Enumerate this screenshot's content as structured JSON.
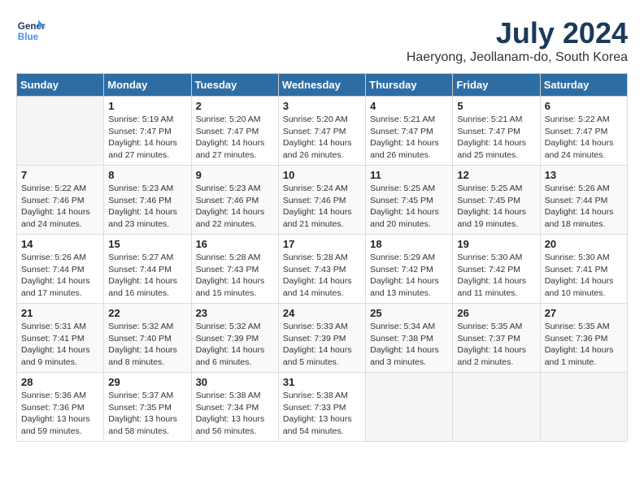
{
  "logo": {
    "line1": "General",
    "line2": "Blue"
  },
  "title": "July 2024",
  "location": "Haeryong, Jeollanam-do, South Korea",
  "days_of_week": [
    "Sunday",
    "Monday",
    "Tuesday",
    "Wednesday",
    "Thursday",
    "Friday",
    "Saturday"
  ],
  "weeks": [
    [
      {
        "day": "",
        "info": ""
      },
      {
        "day": "1",
        "info": "Sunrise: 5:19 AM\nSunset: 7:47 PM\nDaylight: 14 hours\nand 27 minutes."
      },
      {
        "day": "2",
        "info": "Sunrise: 5:20 AM\nSunset: 7:47 PM\nDaylight: 14 hours\nand 27 minutes."
      },
      {
        "day": "3",
        "info": "Sunrise: 5:20 AM\nSunset: 7:47 PM\nDaylight: 14 hours\nand 26 minutes."
      },
      {
        "day": "4",
        "info": "Sunrise: 5:21 AM\nSunset: 7:47 PM\nDaylight: 14 hours\nand 26 minutes."
      },
      {
        "day": "5",
        "info": "Sunrise: 5:21 AM\nSunset: 7:47 PM\nDaylight: 14 hours\nand 25 minutes."
      },
      {
        "day": "6",
        "info": "Sunrise: 5:22 AM\nSunset: 7:47 PM\nDaylight: 14 hours\nand 24 minutes."
      }
    ],
    [
      {
        "day": "7",
        "info": "Sunrise: 5:22 AM\nSunset: 7:46 PM\nDaylight: 14 hours\nand 24 minutes."
      },
      {
        "day": "8",
        "info": "Sunrise: 5:23 AM\nSunset: 7:46 PM\nDaylight: 14 hours\nand 23 minutes."
      },
      {
        "day": "9",
        "info": "Sunrise: 5:23 AM\nSunset: 7:46 PM\nDaylight: 14 hours\nand 22 minutes."
      },
      {
        "day": "10",
        "info": "Sunrise: 5:24 AM\nSunset: 7:46 PM\nDaylight: 14 hours\nand 21 minutes."
      },
      {
        "day": "11",
        "info": "Sunrise: 5:25 AM\nSunset: 7:45 PM\nDaylight: 14 hours\nand 20 minutes."
      },
      {
        "day": "12",
        "info": "Sunrise: 5:25 AM\nSunset: 7:45 PM\nDaylight: 14 hours\nand 19 minutes."
      },
      {
        "day": "13",
        "info": "Sunrise: 5:26 AM\nSunset: 7:44 PM\nDaylight: 14 hours\nand 18 minutes."
      }
    ],
    [
      {
        "day": "14",
        "info": "Sunrise: 5:26 AM\nSunset: 7:44 PM\nDaylight: 14 hours\nand 17 minutes."
      },
      {
        "day": "15",
        "info": "Sunrise: 5:27 AM\nSunset: 7:44 PM\nDaylight: 14 hours\nand 16 minutes."
      },
      {
        "day": "16",
        "info": "Sunrise: 5:28 AM\nSunset: 7:43 PM\nDaylight: 14 hours\nand 15 minutes."
      },
      {
        "day": "17",
        "info": "Sunrise: 5:28 AM\nSunset: 7:43 PM\nDaylight: 14 hours\nand 14 minutes."
      },
      {
        "day": "18",
        "info": "Sunrise: 5:29 AM\nSunset: 7:42 PM\nDaylight: 14 hours\nand 13 minutes."
      },
      {
        "day": "19",
        "info": "Sunrise: 5:30 AM\nSunset: 7:42 PM\nDaylight: 14 hours\nand 11 minutes."
      },
      {
        "day": "20",
        "info": "Sunrise: 5:30 AM\nSunset: 7:41 PM\nDaylight: 14 hours\nand 10 minutes."
      }
    ],
    [
      {
        "day": "21",
        "info": "Sunrise: 5:31 AM\nSunset: 7:41 PM\nDaylight: 14 hours\nand 9 minutes."
      },
      {
        "day": "22",
        "info": "Sunrise: 5:32 AM\nSunset: 7:40 PM\nDaylight: 14 hours\nand 8 minutes."
      },
      {
        "day": "23",
        "info": "Sunrise: 5:32 AM\nSunset: 7:39 PM\nDaylight: 14 hours\nand 6 minutes."
      },
      {
        "day": "24",
        "info": "Sunrise: 5:33 AM\nSunset: 7:39 PM\nDaylight: 14 hours\nand 5 minutes."
      },
      {
        "day": "25",
        "info": "Sunrise: 5:34 AM\nSunset: 7:38 PM\nDaylight: 14 hours\nand 3 minutes."
      },
      {
        "day": "26",
        "info": "Sunrise: 5:35 AM\nSunset: 7:37 PM\nDaylight: 14 hours\nand 2 minutes."
      },
      {
        "day": "27",
        "info": "Sunrise: 5:35 AM\nSunset: 7:36 PM\nDaylight: 14 hours\nand 1 minute."
      }
    ],
    [
      {
        "day": "28",
        "info": "Sunrise: 5:36 AM\nSunset: 7:36 PM\nDaylight: 13 hours\nand 59 minutes."
      },
      {
        "day": "29",
        "info": "Sunrise: 5:37 AM\nSunset: 7:35 PM\nDaylight: 13 hours\nand 58 minutes."
      },
      {
        "day": "30",
        "info": "Sunrise: 5:38 AM\nSunset: 7:34 PM\nDaylight: 13 hours\nand 56 minutes."
      },
      {
        "day": "31",
        "info": "Sunrise: 5:38 AM\nSunset: 7:33 PM\nDaylight: 13 hours\nand 54 minutes."
      },
      {
        "day": "",
        "info": ""
      },
      {
        "day": "",
        "info": ""
      },
      {
        "day": "",
        "info": ""
      }
    ]
  ]
}
